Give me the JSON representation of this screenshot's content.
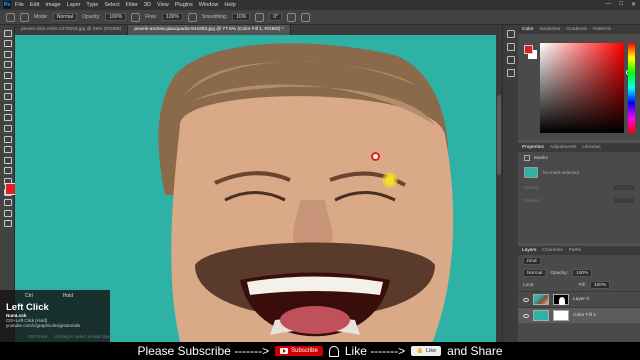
{
  "menubar": {
    "logo": "Ps",
    "items": [
      "File",
      "Edit",
      "Image",
      "Layer",
      "Type",
      "Select",
      "Filter",
      "3D",
      "View",
      "Plugins",
      "Window",
      "Help"
    ]
  },
  "options": {
    "mode_label": "Mode:",
    "mode_value": "Normal",
    "opacity_label": "Opacity:",
    "opacity_value": "100%",
    "flow_label": "Flow:",
    "flow_value": "100%",
    "smoothing_label": "Smoothing:",
    "smoothing_value": "10%",
    "angle_value": "0°"
  },
  "tabs": [
    {
      "label": "pexels-italo-melo-2379004.jpg @ 25% (RGB/8)"
    },
    {
      "label": "pexels-andrea-piacquadio-941693.jpg @ 77.6% (Color Fill 1, RGB/8) *"
    }
  ],
  "color_panel": {
    "tabs": [
      "Color",
      "Swatches",
      "Gradients",
      "Patterns"
    ],
    "foreground": "#e02020",
    "background": "#ffffff"
  },
  "properties_panel": {
    "tabs": [
      "Properties",
      "Adjustments",
      "Libraries"
    ],
    "masks_label": "Masks",
    "no_mask": "No mask selected",
    "density_label": "Density:",
    "feather_label": "Feather:"
  },
  "layers_panel": {
    "tabs": [
      "Layers",
      "Channels",
      "Paths"
    ],
    "kind_label": "Kind",
    "blend_mode": "Normal",
    "opacity_label": "Opacity:",
    "opacity_value": "100%",
    "fill_label": "Fill:",
    "fill_value": "100%",
    "lock_label": "Lock:",
    "layers": [
      {
        "name": "Layer 0"
      },
      {
        "name": "Color Fill 1"
      }
    ]
  },
  "key_overlay": {
    "key1": "Ctrl",
    "key2": "Hold",
    "action": "Left Click",
    "line1": "NumLock",
    "line2": "Ctrl+Left Click [Hold]",
    "line3": "youtube.com/c/graphicdesigntutorials"
  },
  "footer_hint": "Ctrl Press ... clicking to select similar layer",
  "subscribe_bar": {
    "text1": "Please Subscribe ------->",
    "subscribe_label": "Subscribe",
    "text2": "Like ------->",
    "like_label": "Like",
    "text3": "and  Share"
  },
  "colors": {
    "canvas_teal": "#2fb2a6",
    "subscribe_red": "#cc0000"
  }
}
